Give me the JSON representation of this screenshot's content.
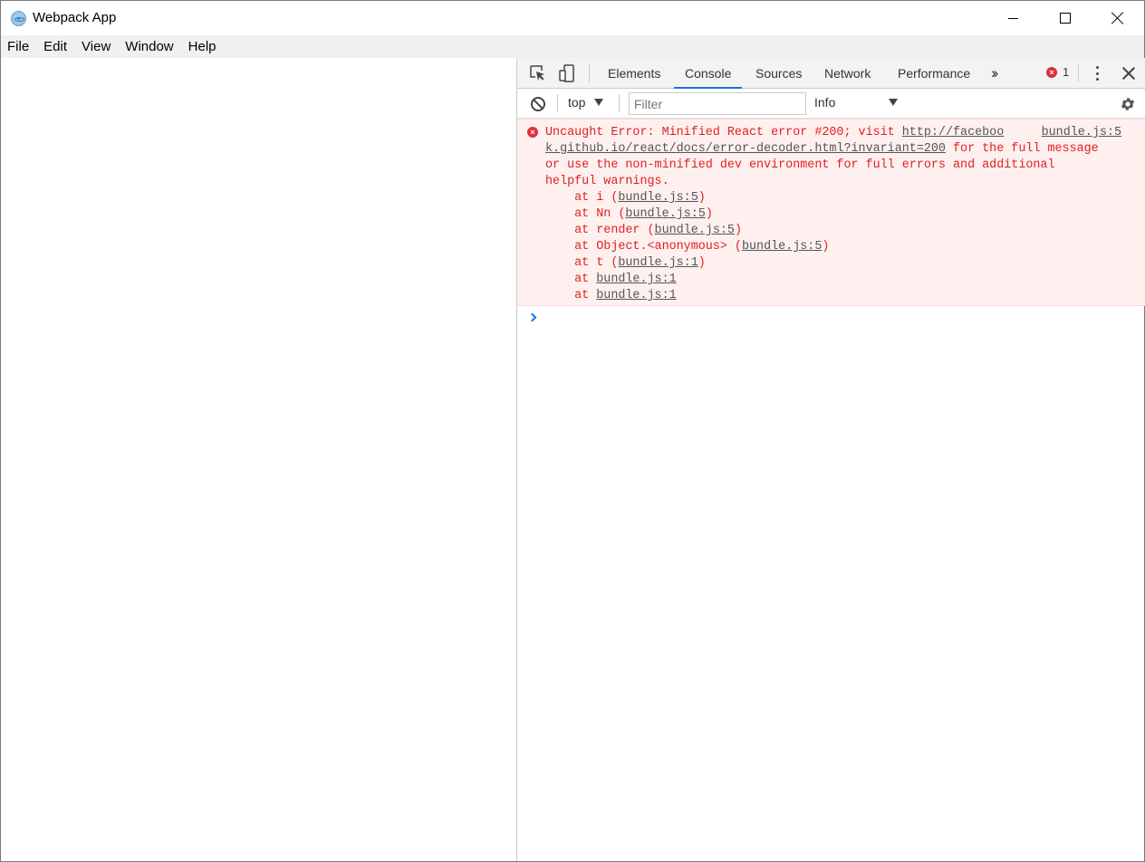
{
  "window": {
    "title": "Webpack App",
    "icon": "electron-atom-icon"
  },
  "menu": {
    "items": [
      "File",
      "Edit",
      "View",
      "Window",
      "Help"
    ]
  },
  "devtools": {
    "tabs": [
      "Elements",
      "Console",
      "Sources",
      "Network",
      "Performance"
    ],
    "active_tab": "Console",
    "error_count": "1",
    "context": "top",
    "filter_placeholder": "Filter",
    "level": "Info",
    "accent_color": "#1a73e8",
    "error_color": "#e02020"
  },
  "console": {
    "error": {
      "line1_prefix": "Uncaught Error: Minified React error #200; visit ",
      "line1_link": "http://faceboo",
      "line2_link": "k.github.io/react/docs/error-decoder.html?invariant=200",
      "line2_suffix": " for the full message",
      "line3": "or use the non-minified dev environment for full errors and additional",
      "line4": "helpful warnings.",
      "source": "bundle.js:5",
      "stack": [
        {
          "prefix": "    at i (",
          "link": "bundle.js:5",
          "suffix": ")"
        },
        {
          "prefix": "    at Nn (",
          "link": "bundle.js:5",
          "suffix": ")"
        },
        {
          "prefix": "    at render (",
          "link": "bundle.js:5",
          "suffix": ")"
        },
        {
          "prefix": "    at Object.<anonymous> (",
          "link": "bundle.js:5",
          "suffix": ")"
        },
        {
          "prefix": "    at t (",
          "link": "bundle.js:1",
          "suffix": ")"
        },
        {
          "prefix": "    at ",
          "link": "bundle.js:1",
          "suffix": ""
        },
        {
          "prefix": "    at ",
          "link": "bundle.js:1",
          "suffix": ""
        }
      ]
    }
  }
}
